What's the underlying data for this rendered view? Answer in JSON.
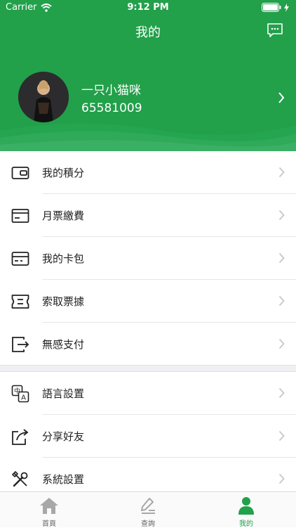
{
  "status_bar": {
    "carrier": "Carrier",
    "time": "9:12 PM"
  },
  "nav": {
    "title": "我的"
  },
  "profile": {
    "name": "一只小猫咪",
    "id": "65581009"
  },
  "menu_group_1": [
    {
      "label": "我的積分",
      "icon": "wallet-icon"
    },
    {
      "label": "月票繳費",
      "icon": "card-icon"
    },
    {
      "label": "我的卡包",
      "icon": "card-holder-icon"
    },
    {
      "label": "索取票據",
      "icon": "ticket-icon"
    },
    {
      "label": "無感支付",
      "icon": "exit-pay-icon"
    }
  ],
  "menu_group_2": [
    {
      "label": "語言設置",
      "icon": "language-icon"
    },
    {
      "label": "分享好友",
      "icon": "share-icon"
    },
    {
      "label": "系統設置",
      "icon": "tools-icon"
    }
  ],
  "language_icon_glyphs": {
    "zh": "中",
    "en": "A"
  },
  "tabs": [
    {
      "label": "首頁",
      "icon": "home-icon",
      "active": false
    },
    {
      "label": "查詢",
      "icon": "edit-icon",
      "active": false
    },
    {
      "label": "我的",
      "icon": "user-icon",
      "active": true
    }
  ],
  "colors": {
    "primary": "#22a04a",
    "text": "#222222",
    "chevron": "#c7c7cc"
  }
}
